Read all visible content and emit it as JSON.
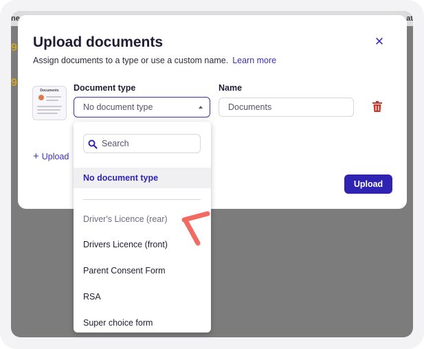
{
  "background": {
    "strip_left": "ne",
    "strip_right": "at",
    "marks": [
      "9",
      "9"
    ]
  },
  "modal": {
    "title": "Upload documents",
    "subtitle": "Assign documents to a type or use a custom name.",
    "learn_more": "Learn more",
    "close_icon": "close-icon"
  },
  "document": {
    "thumbnail_title": "Documents",
    "type_label": "Document type",
    "type_value": "No document type",
    "name_label": "Name",
    "name_value": "Documents",
    "delete_icon": "trash-icon"
  },
  "upload_link": "Upload",
  "upload_button": "Upload",
  "dropdown": {
    "search_placeholder": "Search",
    "items": [
      "No document type",
      "Driver's Licence (rear)",
      "Drivers Licence (front)",
      "Parent Consent Form",
      "RSA",
      "Super choice form"
    ],
    "selected_index": 0
  },
  "colors": {
    "accent": "#3b2fb6",
    "button": "#2f23b2",
    "delete": "#c0392b",
    "annotation": "#f26b63"
  }
}
